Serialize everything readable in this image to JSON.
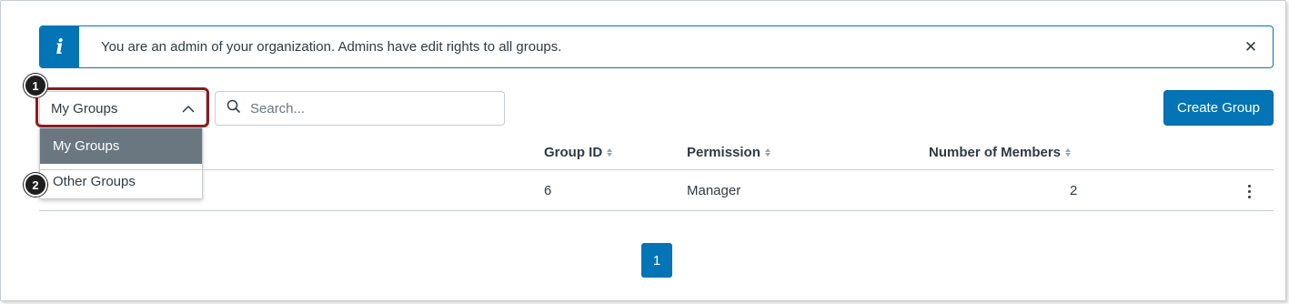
{
  "alert": {
    "icon": "info-icon",
    "icon_glyph": "i",
    "message": "You are an admin of your organization. Admins have edit rights to all groups.",
    "close_glyph": "✕"
  },
  "filter": {
    "selected": "My Groups",
    "options": [
      "My Groups",
      "Other Groups"
    ],
    "active_index": 0
  },
  "search": {
    "placeholder": "Search..."
  },
  "create_button": {
    "label": "Create Group"
  },
  "table": {
    "columns": [
      "Group ID",
      "Permission",
      "Number of Members"
    ],
    "rows": [
      {
        "group_id": "6",
        "permission": "Manager",
        "members": "2"
      }
    ]
  },
  "pagination": {
    "current_page": "1"
  },
  "callouts": [
    "1",
    "2"
  ],
  "colors": {
    "accent": "#0374b5",
    "highlight": "#8b1c1f",
    "active_option": "#6b7780",
    "text": "#2d3b45"
  }
}
